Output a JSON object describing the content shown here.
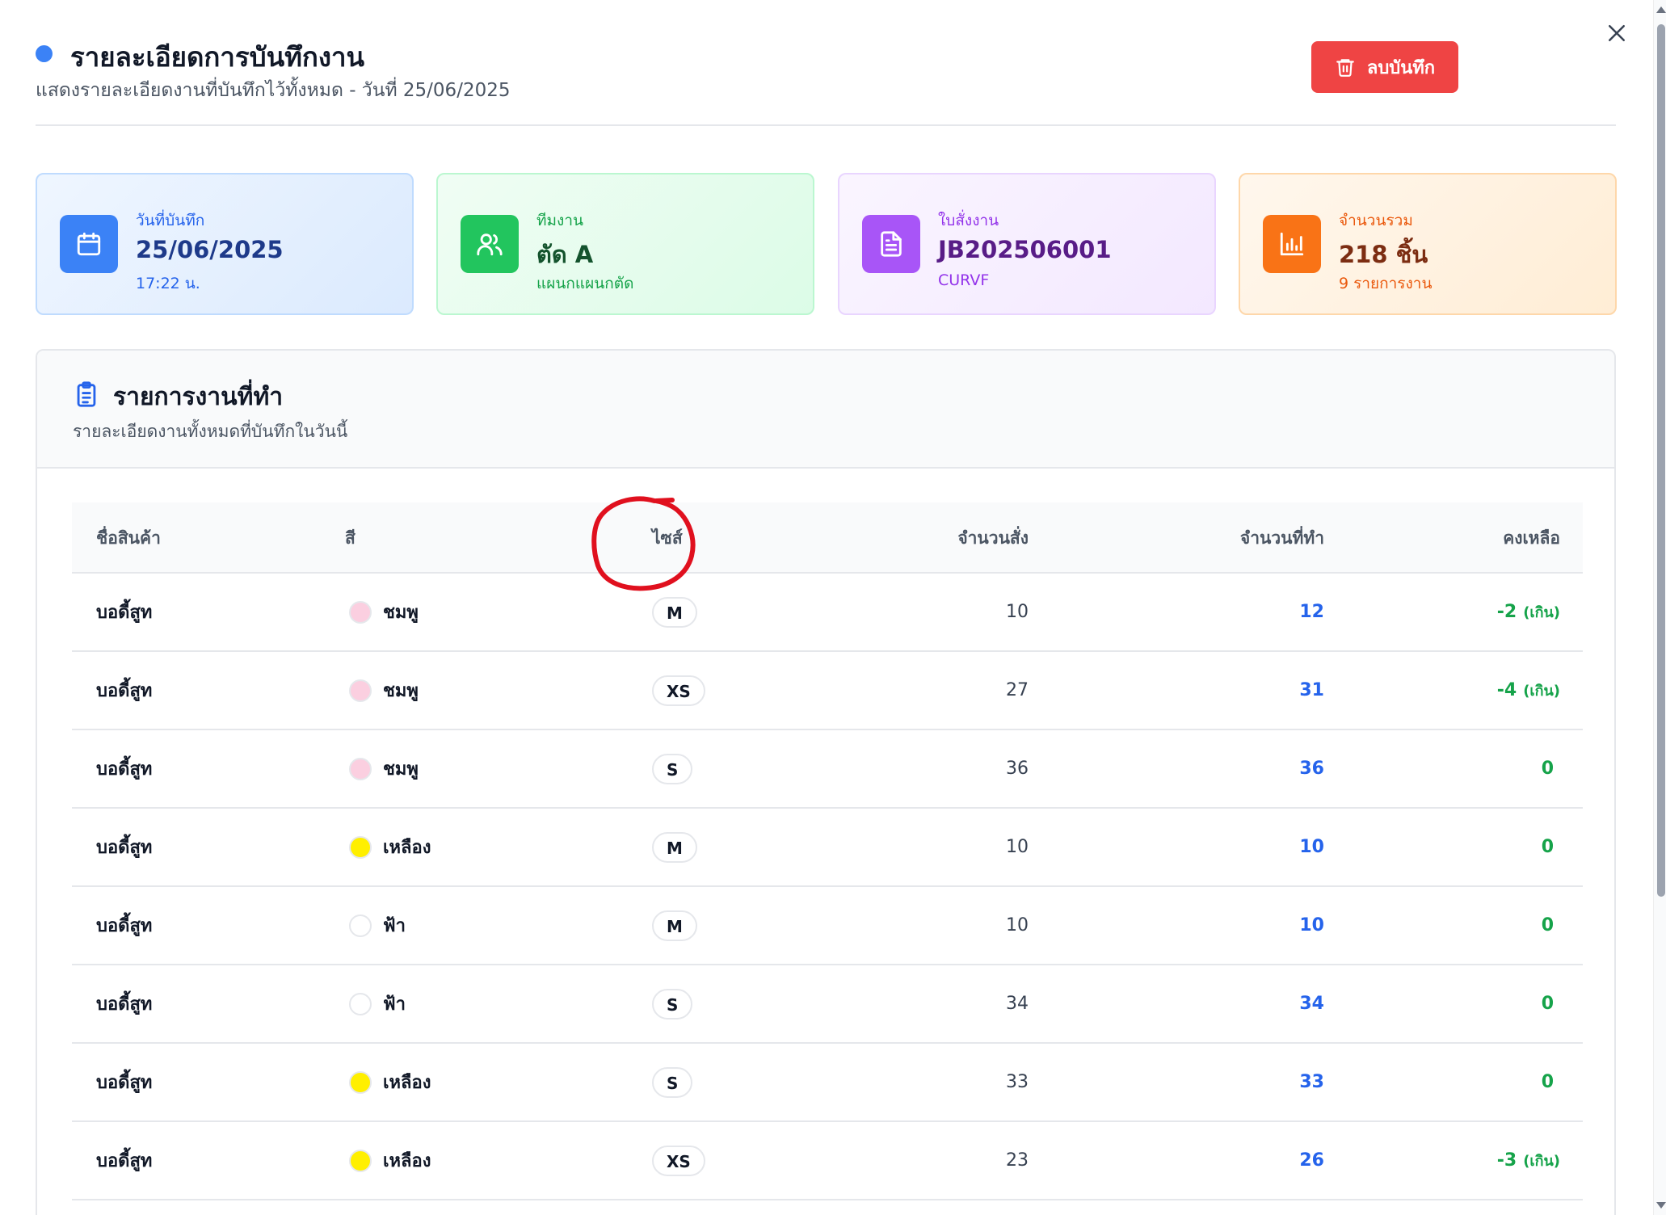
{
  "header": {
    "title": "รายละเอียดการบันทึกงาน",
    "subtitle": "แสดงรายละเอียดงานที่บันทึกไว้ทั้งหมด - วันที่ 25/06/2025",
    "delete_label": "ลบบันทึก"
  },
  "cards": {
    "date": {
      "label": "วันที่บันทึก",
      "value": "25/06/2025",
      "sub": "17:22 น."
    },
    "team": {
      "label": "ทีมงาน",
      "value": "ตัด A",
      "sub": "แผนกแผนกตัด"
    },
    "job": {
      "label": "ใบสั่งงาน",
      "value": "JB202506001",
      "sub": "CURVF"
    },
    "total": {
      "label": "จำนวนรวม",
      "value": "218 ชิ้น",
      "sub": "9 รายการงาน"
    }
  },
  "section": {
    "title": "รายการงานที่ทำ",
    "subtitle": "รายละเอียดงานทั้งหมดที่บันทึกในวันนี้"
  },
  "table": {
    "headers": {
      "name": "ชื่อสินค้า",
      "color": "สี",
      "size": "ไซส์",
      "ordered": "จำนวนสั่ง",
      "done": "จำนวนที่ทำ",
      "remaining": "คงเหลือ"
    },
    "rows": [
      {
        "name": "บอดี้สูท",
        "color": "ชมพู",
        "swatch": "#fbcfe0",
        "size": "M",
        "ordered": "10",
        "done": "12",
        "remaining": "-2",
        "note": "(เกิน)"
      },
      {
        "name": "บอดี้สูท",
        "color": "ชมพู",
        "swatch": "#fbcfe0",
        "size": "XS",
        "ordered": "27",
        "done": "31",
        "remaining": "-4",
        "note": "(เกิน)"
      },
      {
        "name": "บอดี้สูท",
        "color": "ชมพู",
        "swatch": "#fbcfe0",
        "size": "S",
        "ordered": "36",
        "done": "36",
        "remaining": "0",
        "note": ""
      },
      {
        "name": "บอดี้สูท",
        "color": "เหลือง",
        "swatch": "#ffef00",
        "size": "M",
        "ordered": "10",
        "done": "10",
        "remaining": "0",
        "note": ""
      },
      {
        "name": "บอดี้สูท",
        "color": "ฟ้า",
        "swatch": "#ffffff",
        "size": "M",
        "ordered": "10",
        "done": "10",
        "remaining": "0",
        "note": ""
      },
      {
        "name": "บอดี้สูท",
        "color": "ฟ้า",
        "swatch": "#ffffff",
        "size": "S",
        "ordered": "34",
        "done": "34",
        "remaining": "0",
        "note": ""
      },
      {
        "name": "บอดี้สูท",
        "color": "เหลือง",
        "swatch": "#ffef00",
        "size": "S",
        "ordered": "33",
        "done": "33",
        "remaining": "0",
        "note": ""
      },
      {
        "name": "บอดี้สูท",
        "color": "เหลือง",
        "swatch": "#ffef00",
        "size": "XS",
        "ordered": "23",
        "done": "26",
        "remaining": "-3",
        "note": "(เกิน)"
      }
    ]
  },
  "icons": {
    "close": "close-icon",
    "trash": "trash-icon",
    "calendar": "calendar-icon",
    "users": "users-icon",
    "document": "document-icon",
    "chart": "bar-chart-icon",
    "clipboard": "clipboard-list-icon"
  },
  "colors": {
    "accent": "#3b82f6",
    "danger": "#ef4444",
    "success": "#16a34a",
    "link": "#2563eb",
    "annotation": "#e0101e"
  }
}
